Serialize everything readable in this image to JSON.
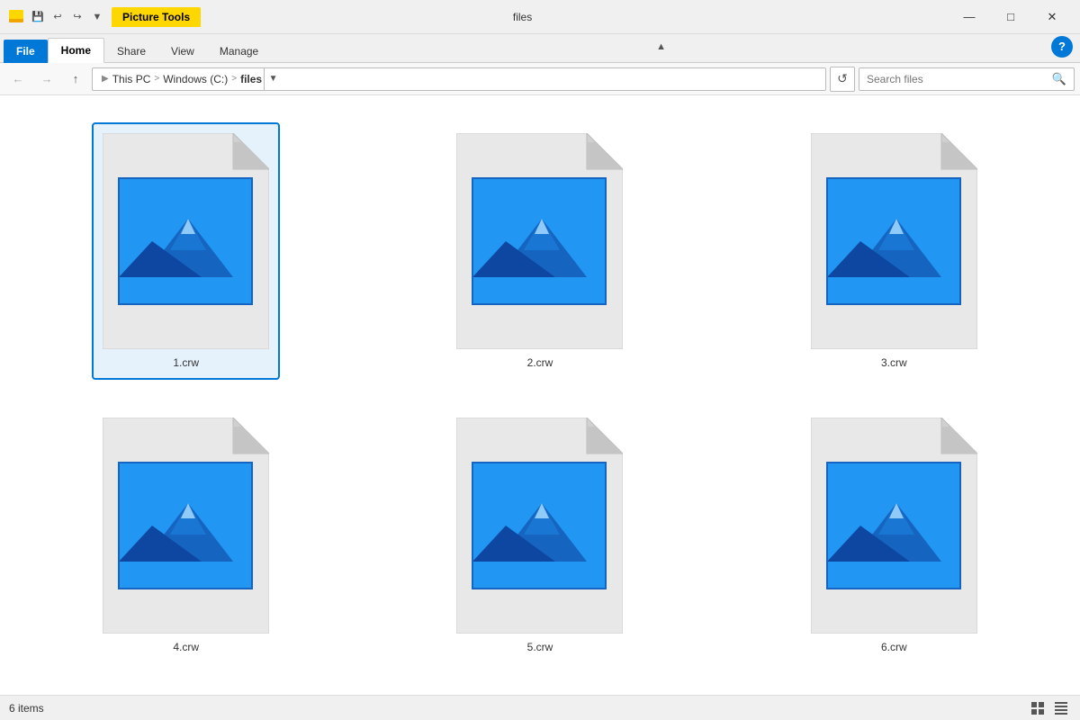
{
  "titleBar": {
    "pictureTools": "Picture Tools",
    "title": "files",
    "minimizeLabel": "Minimize",
    "maximizeLabel": "Maximize",
    "closeLabel": "Close"
  },
  "ribbon": {
    "tabs": [
      {
        "id": "file",
        "label": "File"
      },
      {
        "id": "home",
        "label": "Home"
      },
      {
        "id": "share",
        "label": "Share"
      },
      {
        "id": "view",
        "label": "View"
      },
      {
        "id": "manage",
        "label": "Manage"
      }
    ]
  },
  "addressBar": {
    "backDisabled": true,
    "forwardDisabled": true,
    "upLabel": "Up",
    "path": {
      "thisPc": "This PC",
      "windowsC": "Windows (C:)",
      "files": "files"
    },
    "searchPlaceholder": "Search files"
  },
  "files": [
    {
      "id": 1,
      "name": "1.crw",
      "selected": true
    },
    {
      "id": 2,
      "name": "2.crw",
      "selected": false
    },
    {
      "id": 3,
      "name": "3.crw",
      "selected": false
    },
    {
      "id": 4,
      "name": "4.crw",
      "selected": false
    },
    {
      "id": 5,
      "name": "5.crw",
      "selected": false
    },
    {
      "id": 6,
      "name": "6.crw",
      "selected": false
    }
  ],
  "statusBar": {
    "itemCount": "6 items"
  },
  "colors": {
    "accent": "#0078d7",
    "pictureToolsYellow": "#ffd700",
    "fileTabBlue": "#0078d7"
  }
}
